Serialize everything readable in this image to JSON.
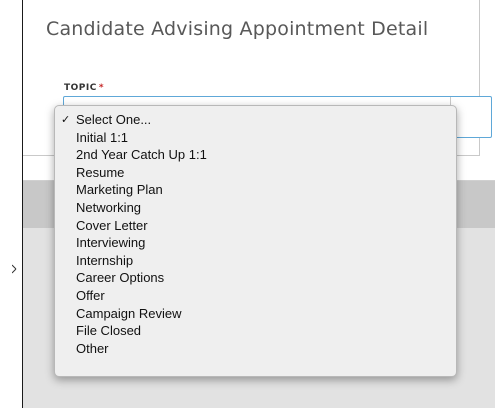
{
  "page": {
    "title": "Candidate Advising Appointment Detail"
  },
  "topic_field": {
    "label": "TOPIC",
    "required_marker": "*",
    "selected": "Select One...",
    "check_glyph": "✓",
    "options": [
      "Select One...",
      "Initial 1:1",
      "2nd Year Catch Up 1:1",
      "Resume",
      "Marketing Plan",
      "Networking",
      "Cover Letter",
      "Interviewing",
      "Internship",
      "Career Options",
      "Offer",
      "Campaign Review",
      "File Closed",
      "Other"
    ]
  },
  "colors": {
    "focus_border": "#5fa8d8",
    "required": "#c62828",
    "title_text": "#585858",
    "dropdown_bg": "#efefef"
  }
}
